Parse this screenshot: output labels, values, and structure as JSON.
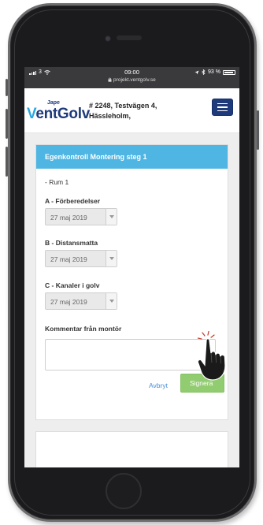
{
  "status_bar": {
    "carrier": "3",
    "time": "09:00",
    "url": "projekt.ventgolv.se",
    "battery": "93 %"
  },
  "header": {
    "logo_small": "Jape",
    "logo_main_v": "V",
    "logo_main_rest": "entGolv",
    "address_line1": "# 2248, Testvägen 4,",
    "address_line2": "Hässleholm,"
  },
  "form": {
    "title": "Egenkontroll Montering steg 1",
    "room": "- Rum 1",
    "sections": [
      {
        "label": "A - Förberedelser",
        "date": "27 maj 2019"
      },
      {
        "label": "B - Distansmatta",
        "date": "27 maj 2019"
      },
      {
        "label": "C - Kanaler i golv",
        "date": "27 maj 2019"
      }
    ],
    "comment_label": "Kommentar från montör",
    "comment_value": "",
    "cancel_label": "Avbryt",
    "sign_label": "Signera"
  },
  "colors": {
    "brand_navy": "#1e3a7a",
    "brand_light_blue": "#2aa8e0",
    "card_header": "#4fb6e3",
    "sign_button": "#92cc70"
  },
  "icons": [
    "wifi-icon",
    "lock-icon",
    "location-icon",
    "bluetooth-icon",
    "battery-icon",
    "menu-icon",
    "hand-pointer-icon"
  ]
}
